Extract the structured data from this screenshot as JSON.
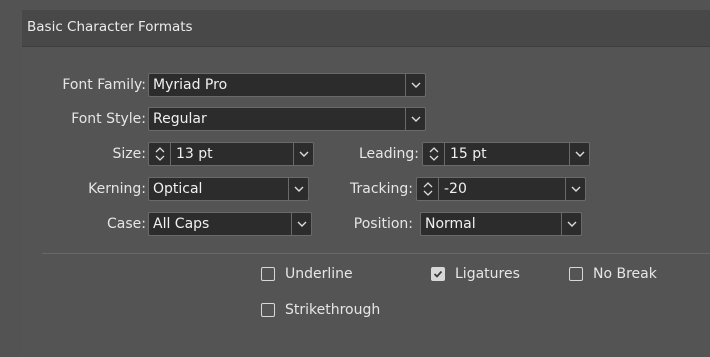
{
  "panel": {
    "title": "Basic Character Formats"
  },
  "fields": {
    "font_family": {
      "label": "Font Family:",
      "value": "Myriad Pro"
    },
    "font_style": {
      "label": "Font Style:",
      "value": "Regular"
    },
    "size": {
      "label": "Size:",
      "value": "13 pt"
    },
    "leading": {
      "label": "Leading:",
      "value": "15 pt"
    },
    "kerning": {
      "label": "Kerning:",
      "value": "Optical"
    },
    "tracking": {
      "label": "Tracking:",
      "value": "-20"
    },
    "case": {
      "label": "Case:",
      "value": "All Caps"
    },
    "position": {
      "label": "Position:",
      "value": "Normal"
    }
  },
  "options": {
    "underline": {
      "label": "Underline",
      "checked": false
    },
    "ligatures": {
      "label": "Ligatures",
      "checked": true
    },
    "no_break": {
      "label": "No Break",
      "checked": false
    },
    "strikethrough": {
      "label": "Strikethrough",
      "checked": false
    }
  },
  "icons": {
    "dropdown": "chevron-down-icon",
    "stepper": "up-down-stepper-icon",
    "check": "checkmark-icon"
  }
}
